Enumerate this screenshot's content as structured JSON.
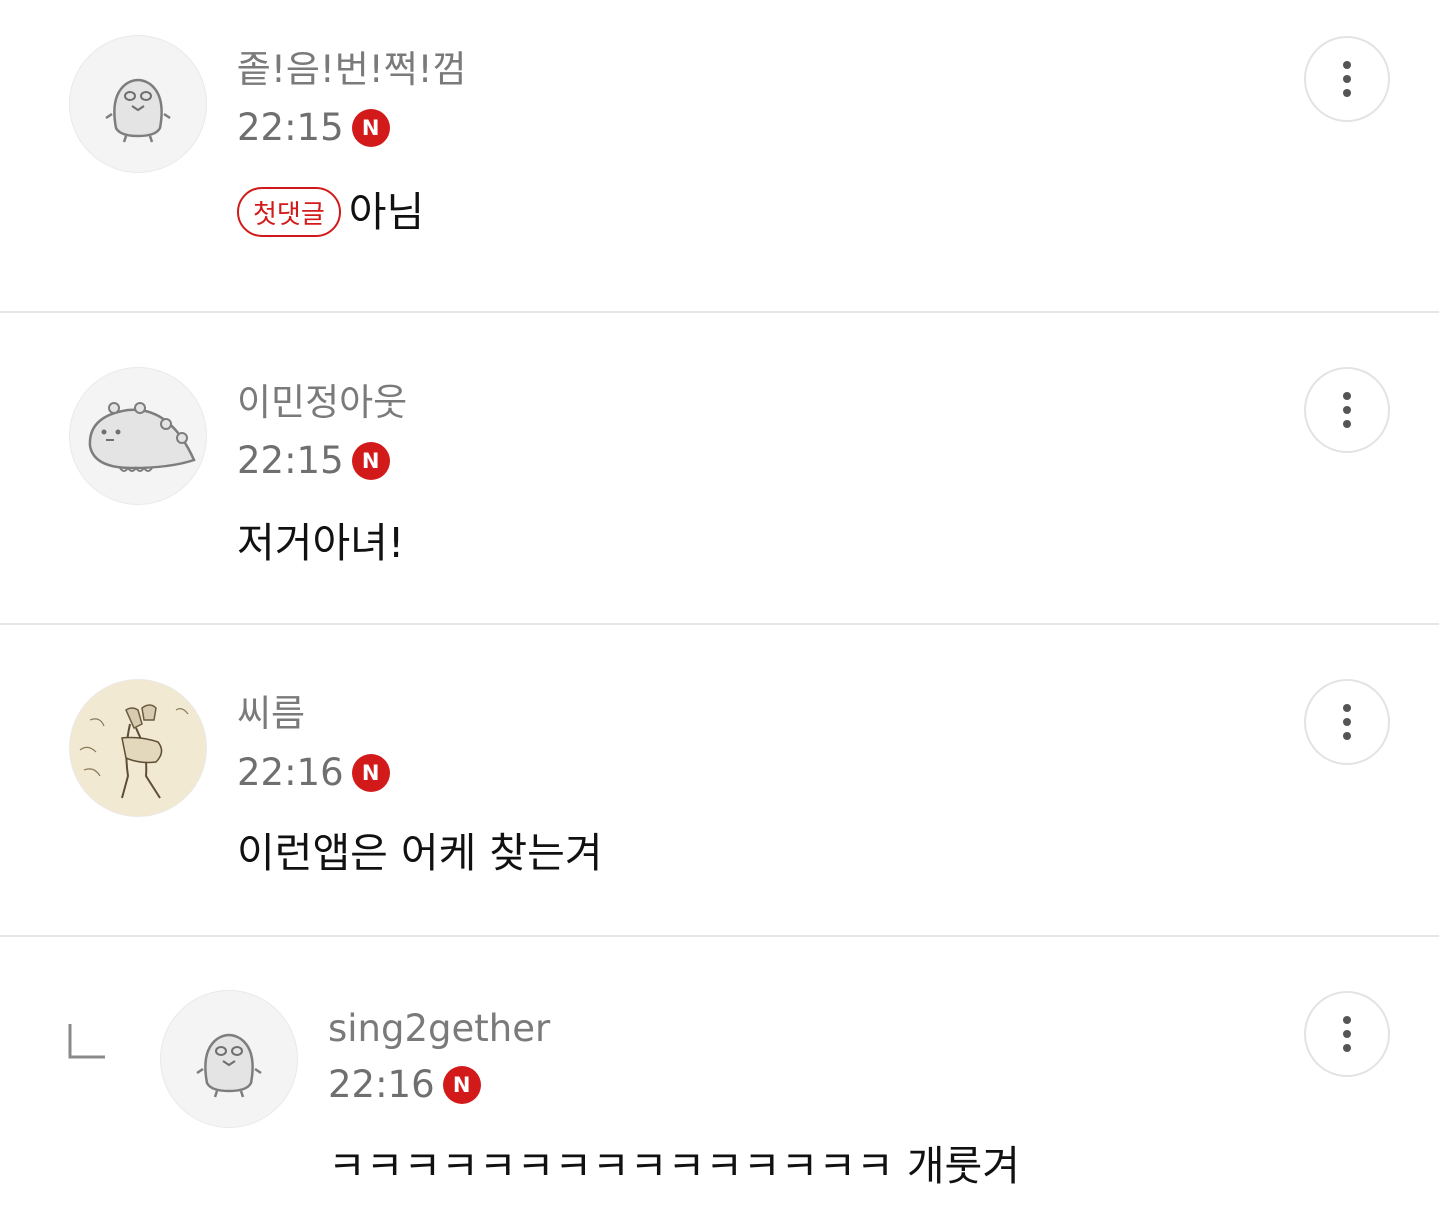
{
  "comments": [
    {
      "nickname": "좉!음!번!쩍!껌",
      "time": "22:15",
      "new_badge": "N",
      "first_badge": "첫댓글",
      "text": "아님",
      "avatar": "egg-character-icon"
    },
    {
      "nickname": "이민정아웃",
      "time": "22:15",
      "new_badge": "N",
      "text": "저거아녀!",
      "avatar": "dinosaur-character-icon"
    },
    {
      "nickname": "씨름",
      "time": "22:16",
      "new_badge": "N",
      "text": "이런앱은 어케 찾는겨",
      "avatar": "ssireum-painting-image"
    },
    {
      "nickname": "sing2gether",
      "time": "22:16",
      "new_badge": "N",
      "text": "ㅋㅋㅋㅋㅋㅋㅋㅋㅋㅋㅋㅋㅋㅋㅋ 개룻겨",
      "avatar": "egg-character-icon",
      "is_reply": true
    }
  ],
  "icons": {
    "more": "more-vertical-icon",
    "reply": "reply-arrow-icon"
  },
  "colors": {
    "accent_red": "#d31a1a",
    "divider": "#e6e6e6",
    "meta_gray": "#6f6f6f"
  }
}
